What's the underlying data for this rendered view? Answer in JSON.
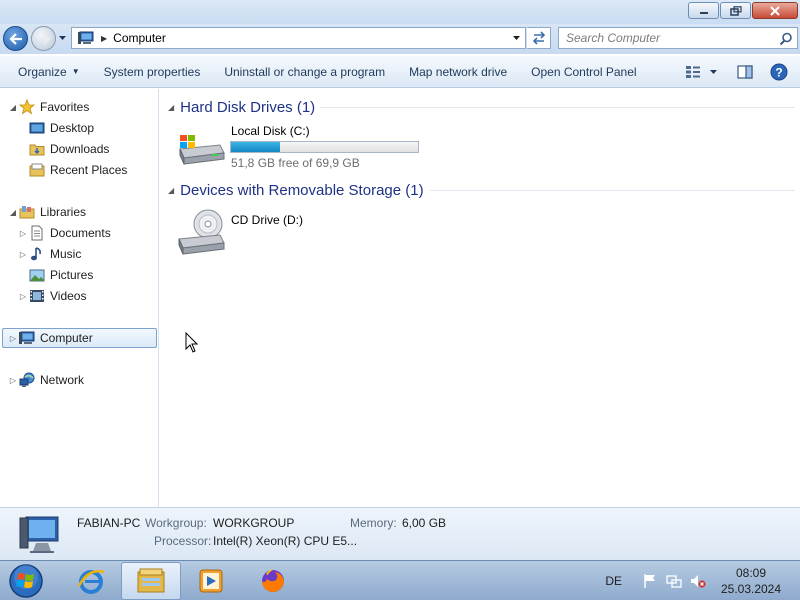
{
  "window": {
    "title": "",
    "controls": {
      "minimize": "minimize",
      "restore": "restore",
      "close": "close"
    }
  },
  "address_bar": {
    "crumbs": [
      "Computer"
    ]
  },
  "search": {
    "placeholder": "Search Computer"
  },
  "command_bar": {
    "organize": "Organize",
    "system_properties": "System properties",
    "uninstall": "Uninstall or change a program",
    "map_drive": "Map network drive",
    "control_panel": "Open Control Panel"
  },
  "nav_pane": {
    "favorites": "Favorites",
    "desktop": "Desktop",
    "downloads": "Downloads",
    "recent_places": "Recent Places",
    "libraries": "Libraries",
    "documents": "Documents",
    "music": "Music",
    "pictures": "Pictures",
    "videos": "Videos",
    "computer": "Computer",
    "network": "Network"
  },
  "content": {
    "groups": [
      {
        "title": "Hard Disk Drives (1)",
        "items": [
          {
            "name": "Local Disk (C:)",
            "free_text": "51,8 GB free of 69,9 GB",
            "used_fraction": 0.26
          }
        ]
      },
      {
        "title": "Devices with Removable Storage (1)",
        "items": [
          {
            "name": "CD Drive (D:)"
          }
        ]
      }
    ]
  },
  "details": {
    "pc_name": "FABIAN-PC",
    "workgroup_label": "Workgroup:",
    "workgroup": "WORKGROUP",
    "memory_label": "Memory:",
    "memory": "6,00 GB",
    "processor_label": "Processor:",
    "processor": "Intel(R) Xeon(R) CPU E5..."
  },
  "taskbar": {
    "language": "DE",
    "time": "08:09",
    "date": "25.03.2024"
  },
  "colors": {
    "accent": "#1e3287",
    "progress": "#1387c4",
    "taskbar": "#8eaacd"
  }
}
